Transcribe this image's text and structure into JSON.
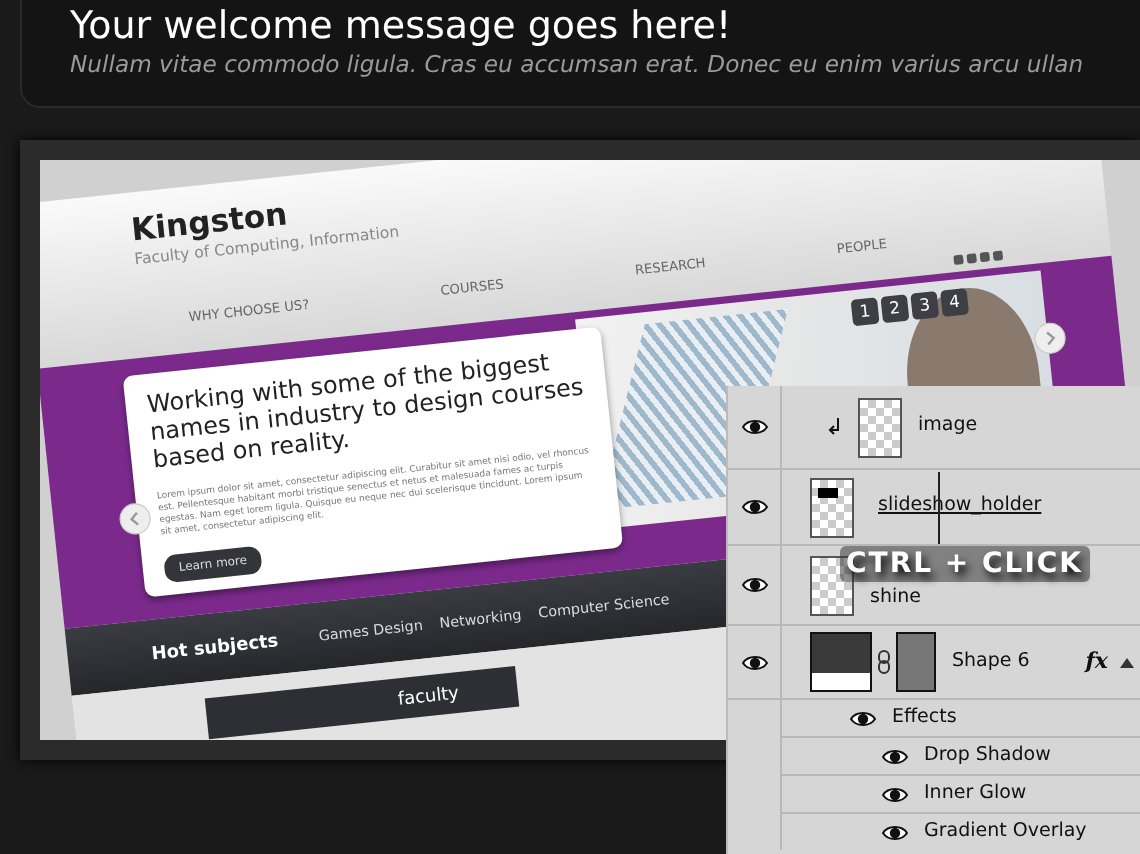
{
  "welcome": {
    "title": "Your welcome message goes here!",
    "subtitle": "Nullam vitae commodo ligula. Cras eu accumsan erat. Donec eu enim varius arcu ullan"
  },
  "mockup": {
    "site_title": "Kingston",
    "site_subtitle": "Faculty of Computing, Information",
    "nav": [
      "WHY CHOOSE US?",
      "COURSES",
      "RESEARCH",
      "PEOPLE"
    ],
    "slide": {
      "headline": "Working with some of the biggest names in industry to design courses based on reality.",
      "body": "Lorem ipsum dolor sit amet, consectetur adipiscing elit. Curabitur sit amet nisi odio, vel rhoncus est. Pellentesque habitant morbi tristique senectus et netus et malesuada fames ac turpis egestas. Nam eget lorem ligula. Quisque eu neque nec dui scelerisque tincidunt. Lorem ipsum sit amet, consectetur adipiscing elit.",
      "button": "Learn more"
    },
    "pager": [
      "1",
      "2",
      "3",
      "4"
    ],
    "hot_subjects": {
      "label": "Hot subjects",
      "items": [
        "Games Design",
        "Networking",
        "Computer Science"
      ]
    },
    "section_title": "faculty"
  },
  "layers_panel": {
    "layers": [
      {
        "kind": "clipped",
        "name": "image",
        "visible": true
      },
      {
        "kind": "holder",
        "name": "slideshow_holder",
        "visible": true
      },
      {
        "kind": "plain",
        "name": "shine",
        "visible": true
      },
      {
        "kind": "shape",
        "name": "Shape 6",
        "visible": true,
        "fx": "fx",
        "effects_label": "Effects",
        "effects": [
          {
            "name": "Drop Shadow",
            "visible": true
          },
          {
            "name": "Inner Glow",
            "visible": true
          },
          {
            "name": "Gradient Overlay",
            "visible": true
          }
        ]
      }
    ]
  },
  "overlay_caption": "CTRL + CLICK"
}
